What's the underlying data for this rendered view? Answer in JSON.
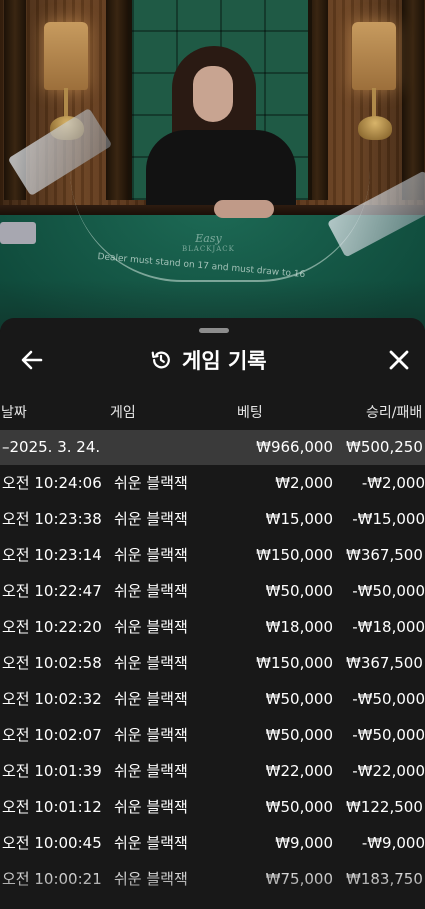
{
  "header": {
    "title": "게임 기록",
    "back_icon": "arrow-left-icon",
    "history_icon": "history-clock-icon",
    "close_icon": "close-icon"
  },
  "table_text": {
    "brand": "Easy",
    "brand_sub": "BLACKJACK",
    "rule": "Dealer must stand on 17 and must draw to 16"
  },
  "columns": {
    "date": "날짜",
    "game": "게임",
    "bet": "베팅",
    "result": "승리/패배"
  },
  "summary": {
    "date": "–2025. 3. 24.",
    "bet": "₩966,000",
    "result": "₩500,250"
  },
  "rows": [
    {
      "time": "오전 10:24:06",
      "game": "쉬운 블랙잭",
      "bet": "₩2,000",
      "result": "-₩2,000"
    },
    {
      "time": "오전 10:23:38",
      "game": "쉬운 블랙잭",
      "bet": "₩15,000",
      "result": "-₩15,000"
    },
    {
      "time": "오전 10:23:14",
      "game": "쉬운 블랙잭",
      "bet": "₩150,000",
      "result": "₩367,500"
    },
    {
      "time": "오전 10:22:47",
      "game": "쉬운 블랙잭",
      "bet": "₩50,000",
      "result": "-₩50,000"
    },
    {
      "time": "오전 10:22:20",
      "game": "쉬운 블랙잭",
      "bet": "₩18,000",
      "result": "-₩18,000"
    },
    {
      "time": "오전 10:02:58",
      "game": "쉬운 블랙잭",
      "bet": "₩150,000",
      "result": "₩367,500"
    },
    {
      "time": "오전 10:02:32",
      "game": "쉬운 블랙잭",
      "bet": "₩50,000",
      "result": "-₩50,000"
    },
    {
      "time": "오전 10:02:07",
      "game": "쉬운 블랙잭",
      "bet": "₩50,000",
      "result": "-₩50,000"
    },
    {
      "time": "오전 10:01:39",
      "game": "쉬운 블랙잭",
      "bet": "₩22,000",
      "result": "-₩22,000"
    },
    {
      "time": "오전 10:01:12",
      "game": "쉬운 블랙잭",
      "bet": "₩50,000",
      "result": "₩122,500"
    },
    {
      "time": "오전 10:00:45",
      "game": "쉬운 블랙잭",
      "bet": "₩9,000",
      "result": "-₩9,000"
    },
    {
      "time": "오전 10:00:21",
      "game": "쉬운 블랙잭",
      "bet": "₩75,000",
      "result": "₩183,750"
    }
  ]
}
